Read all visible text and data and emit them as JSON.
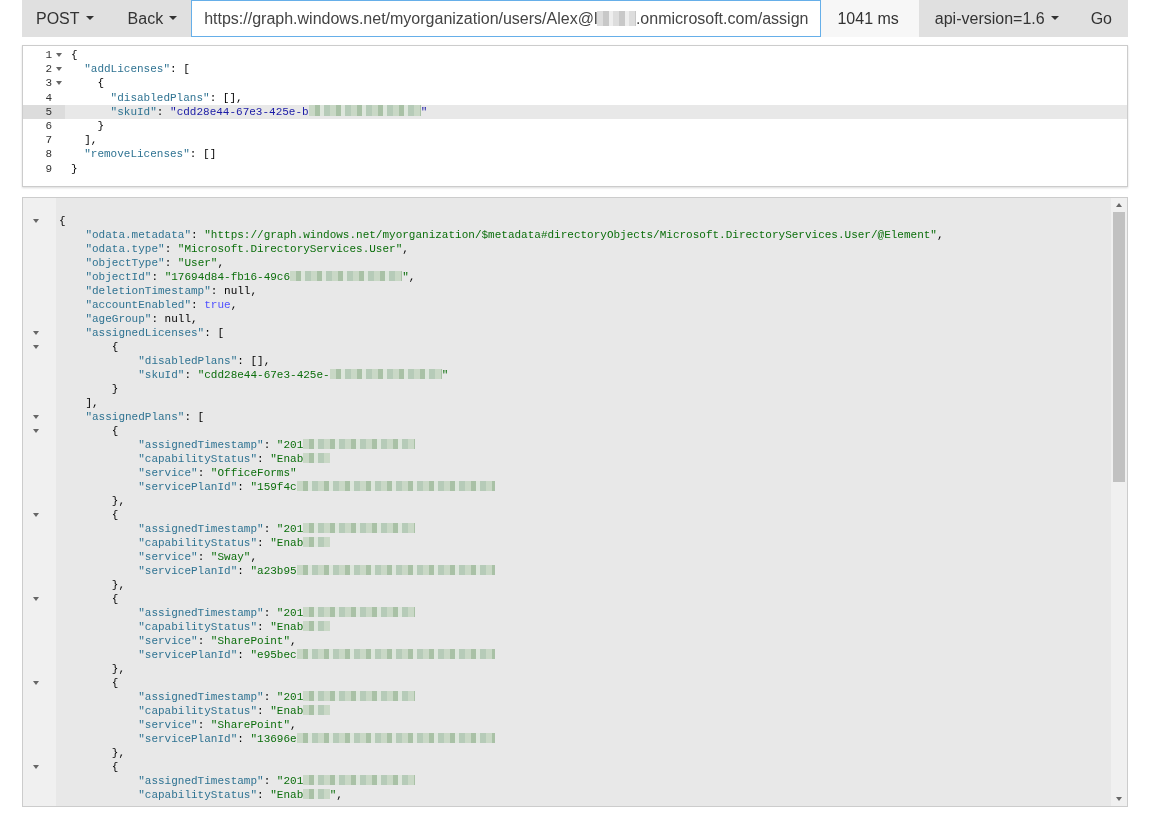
{
  "toolbar": {
    "method": "POST",
    "back": "Back",
    "url": {
      "before": "https://graph.windows.net/myorganization/users/Alex@l",
      "redaction": {
        "kind": "short"
      },
      "after": ".onmicrosoft.com/assign"
    },
    "timing": "1041 ms",
    "api_version": "api-version=1.6",
    "go": "Go"
  },
  "request_editor": {
    "lines": [
      {
        "number": "1",
        "fold": true,
        "active": false,
        "tokens": [
          {
            "kind": "punct",
            "text": "{"
          }
        ]
      },
      {
        "number": "2",
        "fold": true,
        "active": false,
        "tokens": [
          {
            "kind": "key",
            "text": "  \"addLicenses\""
          },
          {
            "kind": "punct",
            "text": ": ["
          }
        ]
      },
      {
        "number": "3",
        "fold": true,
        "active": false,
        "tokens": [
          {
            "kind": "punct",
            "text": "    {"
          }
        ]
      },
      {
        "number": "4",
        "fold": false,
        "active": false,
        "tokens": [
          {
            "kind": "key",
            "text": "      \"disabledPlans\""
          },
          {
            "kind": "punct",
            "text": ": [],"
          }
        ]
      },
      {
        "number": "5",
        "fold": false,
        "active": true,
        "tokens": [
          {
            "kind": "key",
            "text": "      \"skuId\""
          },
          {
            "kind": "punct",
            "text": ": "
          },
          {
            "kind": "string",
            "text": "\"cdd28e44-67e3-425e-b"
          }
        ],
        "redaction": {
          "kind": "long"
        },
        "after": [
          {
            "kind": "string",
            "text": "\""
          }
        ]
      },
      {
        "number": "6",
        "fold": false,
        "active": false,
        "tokens": [
          {
            "kind": "punct",
            "text": "    }"
          }
        ]
      },
      {
        "number": "7",
        "fold": false,
        "active": false,
        "tokens": [
          {
            "kind": "punct",
            "text": "  ],"
          }
        ]
      },
      {
        "number": "8",
        "fold": false,
        "active": false,
        "tokens": [
          {
            "kind": "key",
            "text": "  \"removeLicenses\""
          },
          {
            "kind": "punct",
            "text": ": []"
          }
        ]
      },
      {
        "number": "9",
        "fold": false,
        "active": false,
        "tokens": [
          {
            "kind": "punct",
            "text": "}"
          }
        ]
      }
    ]
  },
  "response_viewer": {
    "lines": [
      {
        "fold": true,
        "tokens": [
          {
            "kind": "punct",
            "text": "{"
          }
        ]
      },
      {
        "fold": false,
        "tokens": [
          {
            "kind": "key",
            "text": "    \"odata.metadata\""
          },
          {
            "kind": "punct",
            "text": ": "
          },
          {
            "kind": "string",
            "text": "\"https://graph.windows.net/myorganization/$metadata#directoryObjects/Microsoft.DirectoryServices.User/@Element\""
          },
          {
            "kind": "punct",
            "text": ","
          }
        ]
      },
      {
        "fold": false,
        "tokens": [
          {
            "kind": "key",
            "text": "    \"odata.type\""
          },
          {
            "kind": "punct",
            "text": ": "
          },
          {
            "kind": "string",
            "text": "\"Microsoft.DirectoryServices.User\""
          },
          {
            "kind": "punct",
            "text": ","
          }
        ]
      },
      {
        "fold": false,
        "tokens": [
          {
            "kind": "key",
            "text": "    \"objectType\""
          },
          {
            "kind": "punct",
            "text": ": "
          },
          {
            "kind": "string",
            "text": "\"User\""
          },
          {
            "kind": "punct",
            "text": ","
          }
        ]
      },
      {
        "fold": false,
        "tokens": [
          {
            "kind": "key",
            "text": "    \"objectId\""
          },
          {
            "kind": "punct",
            "text": ": "
          },
          {
            "kind": "string",
            "text": "\"17694d84-fb16-49c6"
          }
        ],
        "redaction": {
          "kind": "long"
        },
        "after": [
          {
            "kind": "string",
            "text": "\""
          },
          {
            "kind": "punct",
            "text": ","
          }
        ]
      },
      {
        "fold": false,
        "tokens": [
          {
            "kind": "key",
            "text": "    \"deletionTimestamp\""
          },
          {
            "kind": "punct",
            "text": ": null,"
          }
        ]
      },
      {
        "fold": false,
        "tokens": [
          {
            "kind": "key",
            "text": "    \"accountEnabled\""
          },
          {
            "kind": "punct",
            "text": ": "
          },
          {
            "kind": "bool",
            "text": "true"
          },
          {
            "kind": "punct",
            "text": ","
          }
        ]
      },
      {
        "fold": false,
        "tokens": [
          {
            "kind": "key",
            "text": "    \"ageGroup\""
          },
          {
            "kind": "punct",
            "text": ": null,"
          }
        ]
      },
      {
        "fold": true,
        "tokens": [
          {
            "kind": "key",
            "text": "    \"assignedLicenses\""
          },
          {
            "kind": "punct",
            "text": ": ["
          }
        ]
      },
      {
        "fold": true,
        "tokens": [
          {
            "kind": "punct",
            "text": "        {"
          }
        ]
      },
      {
        "fold": false,
        "tokens": [
          {
            "kind": "key",
            "text": "            \"disabledPlans\""
          },
          {
            "kind": "punct",
            "text": ": [],"
          }
        ]
      },
      {
        "fold": false,
        "tokens": [
          {
            "kind": "key",
            "text": "            \"skuId\""
          },
          {
            "kind": "punct",
            "text": ": "
          },
          {
            "kind": "string",
            "text": "\"cdd28e44-67e3-425e-"
          }
        ],
        "redaction": {
          "kind": "long"
        },
        "after": [
          {
            "kind": "string",
            "text": "\""
          }
        ]
      },
      {
        "fold": false,
        "tokens": [
          {
            "kind": "punct",
            "text": "        }"
          }
        ]
      },
      {
        "fold": false,
        "tokens": [
          {
            "kind": "punct",
            "text": "    ],"
          }
        ]
      },
      {
        "fold": true,
        "tokens": [
          {
            "kind": "key",
            "text": "    \"assignedPlans\""
          },
          {
            "kind": "punct",
            "text": ": ["
          }
        ]
      },
      {
        "fold": true,
        "tokens": [
          {
            "kind": "punct",
            "text": "        {"
          }
        ]
      },
      {
        "fold": false,
        "tokens": [
          {
            "kind": "key",
            "text": "            \"assignedTimestamp\""
          },
          {
            "kind": "punct",
            "text": ": "
          },
          {
            "kind": "string",
            "text": "\"201"
          }
        ],
        "redaction": {
          "kind": "long"
        }
      },
      {
        "fold": false,
        "tokens": [
          {
            "kind": "key",
            "text": "            \"capabilityStatus\""
          },
          {
            "kind": "punct",
            "text": ": "
          },
          {
            "kind": "string",
            "text": "\"Enab"
          }
        ],
        "redaction": {
          "kind": "short"
        }
      },
      {
        "fold": false,
        "tokens": [
          {
            "kind": "key",
            "text": "            \"service\""
          },
          {
            "kind": "punct",
            "text": ": "
          },
          {
            "kind": "string",
            "text": "\"OfficeForms\""
          }
        ]
      },
      {
        "fold": false,
        "tokens": [
          {
            "kind": "key",
            "text": "            \"servicePlanId\""
          },
          {
            "kind": "punct",
            "text": ": "
          },
          {
            "kind": "string",
            "text": "\"159f4c"
          }
        ],
        "redaction": {
          "kind": "xlong"
        }
      },
      {
        "fold": false,
        "tokens": [
          {
            "kind": "punct",
            "text": "        },"
          }
        ]
      },
      {
        "fold": true,
        "tokens": [
          {
            "kind": "punct",
            "text": "        {"
          }
        ]
      },
      {
        "fold": false,
        "tokens": [
          {
            "kind": "key",
            "text": "            \"assignedTimestamp\""
          },
          {
            "kind": "punct",
            "text": ": "
          },
          {
            "kind": "string",
            "text": "\"201"
          }
        ],
        "redaction": {
          "kind": "long"
        }
      },
      {
        "fold": false,
        "tokens": [
          {
            "kind": "key",
            "text": "            \"capabilityStatus\""
          },
          {
            "kind": "punct",
            "text": ": "
          },
          {
            "kind": "string",
            "text": "\"Enab"
          }
        ],
        "redaction": {
          "kind": "short"
        }
      },
      {
        "fold": false,
        "tokens": [
          {
            "kind": "key",
            "text": "            \"service\""
          },
          {
            "kind": "punct",
            "text": ": "
          },
          {
            "kind": "string",
            "text": "\"Sway\""
          },
          {
            "kind": "punct",
            "text": ","
          }
        ]
      },
      {
        "fold": false,
        "tokens": [
          {
            "kind": "key",
            "text": "            \"servicePlanId\""
          },
          {
            "kind": "punct",
            "text": ": "
          },
          {
            "kind": "string",
            "text": "\"a23b95"
          }
        ],
        "redaction": {
          "kind": "xlong"
        }
      },
      {
        "fold": false,
        "tokens": [
          {
            "kind": "punct",
            "text": "        },"
          }
        ]
      },
      {
        "fold": true,
        "tokens": [
          {
            "kind": "punct",
            "text": "        {"
          }
        ]
      },
      {
        "fold": false,
        "tokens": [
          {
            "kind": "key",
            "text": "            \"assignedTimestamp\""
          },
          {
            "kind": "punct",
            "text": ": "
          },
          {
            "kind": "string",
            "text": "\"201"
          }
        ],
        "redaction": {
          "kind": "long"
        }
      },
      {
        "fold": false,
        "tokens": [
          {
            "kind": "key",
            "text": "            \"capabilityStatus\""
          },
          {
            "kind": "punct",
            "text": ": "
          },
          {
            "kind": "string",
            "text": "\"Enab"
          }
        ],
        "redaction": {
          "kind": "short"
        }
      },
      {
        "fold": false,
        "tokens": [
          {
            "kind": "key",
            "text": "            \"service\""
          },
          {
            "kind": "punct",
            "text": ": "
          },
          {
            "kind": "string",
            "text": "\"SharePoint\""
          },
          {
            "kind": "punct",
            "text": ","
          }
        ]
      },
      {
        "fold": false,
        "tokens": [
          {
            "kind": "key",
            "text": "            \"servicePlanId\""
          },
          {
            "kind": "punct",
            "text": ": "
          },
          {
            "kind": "string",
            "text": "\"e95bec"
          }
        ],
        "redaction": {
          "kind": "xlong"
        }
      },
      {
        "fold": false,
        "tokens": [
          {
            "kind": "punct",
            "text": "        },"
          }
        ]
      },
      {
        "fold": true,
        "tokens": [
          {
            "kind": "punct",
            "text": "        {"
          }
        ]
      },
      {
        "fold": false,
        "tokens": [
          {
            "kind": "key",
            "text": "            \"assignedTimestamp\""
          },
          {
            "kind": "punct",
            "text": ": "
          },
          {
            "kind": "string",
            "text": "\"201"
          }
        ],
        "redaction": {
          "kind": "long"
        }
      },
      {
        "fold": false,
        "tokens": [
          {
            "kind": "key",
            "text": "            \"capabilityStatus\""
          },
          {
            "kind": "punct",
            "text": ": "
          },
          {
            "kind": "string",
            "text": "\"Enab"
          }
        ],
        "redaction": {
          "kind": "short"
        }
      },
      {
        "fold": false,
        "tokens": [
          {
            "kind": "key",
            "text": "            \"service\""
          },
          {
            "kind": "punct",
            "text": ": "
          },
          {
            "kind": "string",
            "text": "\"SharePoint\""
          },
          {
            "kind": "punct",
            "text": ","
          }
        ]
      },
      {
        "fold": false,
        "tokens": [
          {
            "kind": "key",
            "text": "            \"servicePlanId\""
          },
          {
            "kind": "punct",
            "text": ": "
          },
          {
            "kind": "string",
            "text": "\"13696e"
          }
        ],
        "redaction": {
          "kind": "xlong"
        }
      },
      {
        "fold": false,
        "tokens": [
          {
            "kind": "punct",
            "text": "        },"
          }
        ]
      },
      {
        "fold": true,
        "tokens": [
          {
            "kind": "punct",
            "text": "        {"
          }
        ]
      },
      {
        "fold": false,
        "tokens": [
          {
            "kind": "key",
            "text": "            \"assignedTimestamp\""
          },
          {
            "kind": "punct",
            "text": ": "
          },
          {
            "kind": "string",
            "text": "\"201"
          }
        ],
        "redaction": {
          "kind": "long"
        }
      },
      {
        "fold": false,
        "tokens": [
          {
            "kind": "key",
            "text": "            \"capabilityStatus\""
          },
          {
            "kind": "punct",
            "text": ": "
          },
          {
            "kind": "string",
            "text": "\"Enab"
          }
        ],
        "redaction": {
          "kind": "short"
        },
        "after": [
          {
            "kind": "string",
            "text": "\""
          },
          {
            "kind": "punct",
            "text": ","
          }
        ]
      }
    ]
  }
}
